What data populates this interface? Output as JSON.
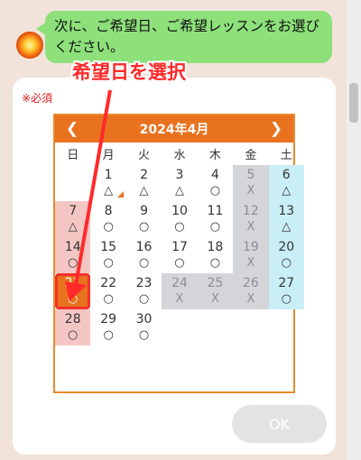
{
  "chat": {
    "message": "次に、ご希望日、ご希望レッスンをお選びください。"
  },
  "annotation": {
    "label": "希望日を選択",
    "color": "#ff2a2a"
  },
  "form": {
    "required_label": "※必須",
    "ok_label": "OK"
  },
  "calendar": {
    "title": "2024年4月",
    "prev_symbol": "❮",
    "next_symbol": "❯",
    "weekdays": [
      "日",
      "月",
      "火",
      "水",
      "木",
      "金",
      "土"
    ],
    "accent_color": "#e9721f",
    "days": [
      {
        "day": "",
        "mark": "",
        "status": "empty"
      },
      {
        "day": "1",
        "mark": "△",
        "status": "open",
        "today": true
      },
      {
        "day": "2",
        "mark": "△",
        "status": "open"
      },
      {
        "day": "3",
        "mark": "△",
        "status": "open"
      },
      {
        "day": "4",
        "mark": "○",
        "status": "open"
      },
      {
        "day": "5",
        "mark": "X",
        "status": "closed"
      },
      {
        "day": "6",
        "mark": "△",
        "status": "sat"
      },
      {
        "day": "7",
        "mark": "△",
        "status": "sun"
      },
      {
        "day": "8",
        "mark": "○",
        "status": "open"
      },
      {
        "day": "9",
        "mark": "○",
        "status": "open"
      },
      {
        "day": "10",
        "mark": "○",
        "status": "open"
      },
      {
        "day": "11",
        "mark": "○",
        "status": "open"
      },
      {
        "day": "12",
        "mark": "X",
        "status": "closed"
      },
      {
        "day": "13",
        "mark": "△",
        "status": "sat"
      },
      {
        "day": "14",
        "mark": "○",
        "status": "sun"
      },
      {
        "day": "15",
        "mark": "○",
        "status": "open"
      },
      {
        "day": "16",
        "mark": "○",
        "status": "open"
      },
      {
        "day": "17",
        "mark": "○",
        "status": "open"
      },
      {
        "day": "18",
        "mark": "○",
        "status": "open"
      },
      {
        "day": "19",
        "mark": "X",
        "status": "closed"
      },
      {
        "day": "20",
        "mark": "○",
        "status": "sat"
      },
      {
        "day": "21",
        "mark": "○",
        "status": "selected"
      },
      {
        "day": "22",
        "mark": "○",
        "status": "open"
      },
      {
        "day": "23",
        "mark": "○",
        "status": "open"
      },
      {
        "day": "24",
        "mark": "X",
        "status": "closed"
      },
      {
        "day": "25",
        "mark": "X",
        "status": "closed"
      },
      {
        "day": "26",
        "mark": "X",
        "status": "closed"
      },
      {
        "day": "27",
        "mark": "○",
        "status": "sat"
      },
      {
        "day": "28",
        "mark": "○",
        "status": "sun"
      },
      {
        "day": "29",
        "mark": "○",
        "status": "open"
      },
      {
        "day": "30",
        "mark": "○",
        "status": "open"
      },
      {
        "day": "",
        "mark": "",
        "status": "empty"
      },
      {
        "day": "",
        "mark": "",
        "status": "empty"
      },
      {
        "day": "",
        "mark": "",
        "status": "empty"
      },
      {
        "day": "",
        "mark": "",
        "status": "empty"
      }
    ]
  }
}
